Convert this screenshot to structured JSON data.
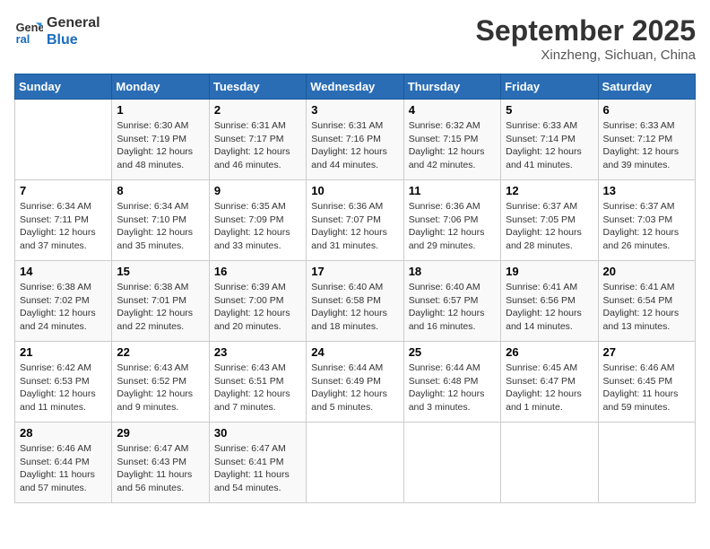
{
  "header": {
    "logo_line1": "General",
    "logo_line2": "Blue",
    "month": "September 2025",
    "location": "Xinzheng, Sichuan, China"
  },
  "days_of_week": [
    "Sunday",
    "Monday",
    "Tuesday",
    "Wednesday",
    "Thursday",
    "Friday",
    "Saturday"
  ],
  "weeks": [
    [
      {
        "day": "",
        "info": ""
      },
      {
        "day": "1",
        "info": "Sunrise: 6:30 AM\nSunset: 7:19 PM\nDaylight: 12 hours\nand 48 minutes."
      },
      {
        "day": "2",
        "info": "Sunrise: 6:31 AM\nSunset: 7:17 PM\nDaylight: 12 hours\nand 46 minutes."
      },
      {
        "day": "3",
        "info": "Sunrise: 6:31 AM\nSunset: 7:16 PM\nDaylight: 12 hours\nand 44 minutes."
      },
      {
        "day": "4",
        "info": "Sunrise: 6:32 AM\nSunset: 7:15 PM\nDaylight: 12 hours\nand 42 minutes."
      },
      {
        "day": "5",
        "info": "Sunrise: 6:33 AM\nSunset: 7:14 PM\nDaylight: 12 hours\nand 41 minutes."
      },
      {
        "day": "6",
        "info": "Sunrise: 6:33 AM\nSunset: 7:12 PM\nDaylight: 12 hours\nand 39 minutes."
      }
    ],
    [
      {
        "day": "7",
        "info": "Sunrise: 6:34 AM\nSunset: 7:11 PM\nDaylight: 12 hours\nand 37 minutes."
      },
      {
        "day": "8",
        "info": "Sunrise: 6:34 AM\nSunset: 7:10 PM\nDaylight: 12 hours\nand 35 minutes."
      },
      {
        "day": "9",
        "info": "Sunrise: 6:35 AM\nSunset: 7:09 PM\nDaylight: 12 hours\nand 33 minutes."
      },
      {
        "day": "10",
        "info": "Sunrise: 6:36 AM\nSunset: 7:07 PM\nDaylight: 12 hours\nand 31 minutes."
      },
      {
        "day": "11",
        "info": "Sunrise: 6:36 AM\nSunset: 7:06 PM\nDaylight: 12 hours\nand 29 minutes."
      },
      {
        "day": "12",
        "info": "Sunrise: 6:37 AM\nSunset: 7:05 PM\nDaylight: 12 hours\nand 28 minutes."
      },
      {
        "day": "13",
        "info": "Sunrise: 6:37 AM\nSunset: 7:03 PM\nDaylight: 12 hours\nand 26 minutes."
      }
    ],
    [
      {
        "day": "14",
        "info": "Sunrise: 6:38 AM\nSunset: 7:02 PM\nDaylight: 12 hours\nand 24 minutes."
      },
      {
        "day": "15",
        "info": "Sunrise: 6:38 AM\nSunset: 7:01 PM\nDaylight: 12 hours\nand 22 minutes."
      },
      {
        "day": "16",
        "info": "Sunrise: 6:39 AM\nSunset: 7:00 PM\nDaylight: 12 hours\nand 20 minutes."
      },
      {
        "day": "17",
        "info": "Sunrise: 6:40 AM\nSunset: 6:58 PM\nDaylight: 12 hours\nand 18 minutes."
      },
      {
        "day": "18",
        "info": "Sunrise: 6:40 AM\nSunset: 6:57 PM\nDaylight: 12 hours\nand 16 minutes."
      },
      {
        "day": "19",
        "info": "Sunrise: 6:41 AM\nSunset: 6:56 PM\nDaylight: 12 hours\nand 14 minutes."
      },
      {
        "day": "20",
        "info": "Sunrise: 6:41 AM\nSunset: 6:54 PM\nDaylight: 12 hours\nand 13 minutes."
      }
    ],
    [
      {
        "day": "21",
        "info": "Sunrise: 6:42 AM\nSunset: 6:53 PM\nDaylight: 12 hours\nand 11 minutes."
      },
      {
        "day": "22",
        "info": "Sunrise: 6:43 AM\nSunset: 6:52 PM\nDaylight: 12 hours\nand 9 minutes."
      },
      {
        "day": "23",
        "info": "Sunrise: 6:43 AM\nSunset: 6:51 PM\nDaylight: 12 hours\nand 7 minutes."
      },
      {
        "day": "24",
        "info": "Sunrise: 6:44 AM\nSunset: 6:49 PM\nDaylight: 12 hours\nand 5 minutes."
      },
      {
        "day": "25",
        "info": "Sunrise: 6:44 AM\nSunset: 6:48 PM\nDaylight: 12 hours\nand 3 minutes."
      },
      {
        "day": "26",
        "info": "Sunrise: 6:45 AM\nSunset: 6:47 PM\nDaylight: 12 hours\nand 1 minute."
      },
      {
        "day": "27",
        "info": "Sunrise: 6:46 AM\nSunset: 6:45 PM\nDaylight: 11 hours\nand 59 minutes."
      }
    ],
    [
      {
        "day": "28",
        "info": "Sunrise: 6:46 AM\nSunset: 6:44 PM\nDaylight: 11 hours\nand 57 minutes."
      },
      {
        "day": "29",
        "info": "Sunrise: 6:47 AM\nSunset: 6:43 PM\nDaylight: 11 hours\nand 56 minutes."
      },
      {
        "day": "30",
        "info": "Sunrise: 6:47 AM\nSunset: 6:41 PM\nDaylight: 11 hours\nand 54 minutes."
      },
      {
        "day": "",
        "info": ""
      },
      {
        "day": "",
        "info": ""
      },
      {
        "day": "",
        "info": ""
      },
      {
        "day": "",
        "info": ""
      }
    ]
  ]
}
